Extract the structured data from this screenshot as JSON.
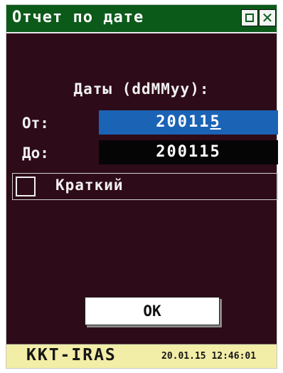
{
  "window": {
    "title": "Отчет по дате"
  },
  "form": {
    "dates_label": "Даты (ddMMyy):",
    "from_label": "От:",
    "from_value_main": "20011",
    "from_value_cursor": "5",
    "to_label": "До:",
    "to_value": "200115",
    "short_label": "Краткий",
    "short_checked": false,
    "ok_label": "OK"
  },
  "status": {
    "app_name": "KKT-IRAS",
    "datetime": "20.01.15 12:46:01"
  },
  "colors": {
    "background": "#2e0b18",
    "titlebar": "#0c5a1a",
    "selected_field": "#1b63b5",
    "field": "#050505",
    "statusbar": "#f2eda7"
  }
}
